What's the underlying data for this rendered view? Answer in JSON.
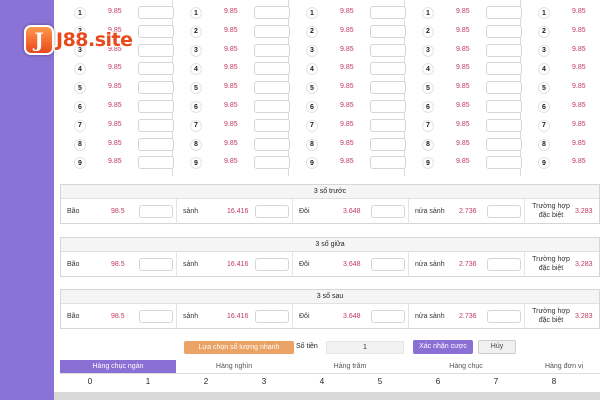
{
  "logo": {
    "mark": "J",
    "text": "J88.site"
  },
  "grid": {
    "rows": [
      {
        "num": "1",
        "rates": [
          "9.85",
          "9.85",
          "9.85",
          "9.85",
          "9.85"
        ]
      },
      {
        "num": "2",
        "rates": [
          "9.85",
          "9.85",
          "9.85",
          "9.85",
          "9.85"
        ]
      },
      {
        "num": "3",
        "rates": [
          "9.85",
          "9.85",
          "9.85",
          "9.85",
          "9.85"
        ]
      },
      {
        "num": "4",
        "rates": [
          "9.85",
          "9.85",
          "9.85",
          "9.85",
          "9.85"
        ]
      },
      {
        "num": "5",
        "rates": [
          "9.85",
          "9.85",
          "9.85",
          "9.85",
          "9.85"
        ]
      },
      {
        "num": "6",
        "rates": [
          "9.85",
          "9.85",
          "9.85",
          "9.85",
          "9.85"
        ]
      },
      {
        "num": "7",
        "rates": [
          "9.85",
          "9.85",
          "9.85",
          "9.85",
          "9.85"
        ]
      },
      {
        "num": "8",
        "rates": [
          "9.85",
          "9.85",
          "9.85",
          "9.85",
          "9.85"
        ]
      },
      {
        "num": "9",
        "rates": [
          "9.85",
          "9.85",
          "9.85",
          "9.85",
          "9.85"
        ]
      }
    ]
  },
  "panels": [
    {
      "title": "3 số trước",
      "items": [
        {
          "label": "Bão",
          "rate": "98.5"
        },
        {
          "label": "sảnh",
          "rate": "16.416"
        },
        {
          "label": "Đôi",
          "rate": "3.648"
        },
        {
          "label": "nửa sảnh",
          "rate": "2.736"
        },
        {
          "label": "Trường hợp đặc biệt",
          "rate": "3.283"
        }
      ]
    },
    {
      "title": "3 số giữa",
      "items": [
        {
          "label": "Bão",
          "rate": "98.5"
        },
        {
          "label": "sảnh",
          "rate": "16.416"
        },
        {
          "label": "Đôi",
          "rate": "3.648"
        },
        {
          "label": "nửa sảnh",
          "rate": "2.736"
        },
        {
          "label": "Trường hợp đặc biệt",
          "rate": "3.283"
        }
      ]
    },
    {
      "title": "3 số sau",
      "items": [
        {
          "label": "Bão",
          "rate": "98.5"
        },
        {
          "label": "sảnh",
          "rate": "16.416"
        },
        {
          "label": "Đôi",
          "rate": "3.648"
        },
        {
          "label": "nửa sảnh",
          "rate": "2.736"
        },
        {
          "label": "Trường hợp đặc biệt",
          "rate": "3.283"
        }
      ]
    }
  ],
  "bet_bar": {
    "quick_select_label": "Lựa chọn số lượng nhanh",
    "amount_label": "Số tiền",
    "amount_value": "1",
    "confirm_label": "Xác nhận cược",
    "cancel_label": "Hủy"
  },
  "place_tabs": [
    "Hàng chục ngàn",
    "Hàng nghìn",
    "Hàng trăm",
    "Hàng chục",
    "Hàng đơn vị"
  ],
  "digits": [
    "0",
    "1",
    "2",
    "3",
    "4",
    "5",
    "6",
    "7",
    "8"
  ],
  "colors": {
    "accent": "#8a6fd4",
    "sidebar": "#8a73d6",
    "rate": "#c0395d",
    "quick_button": "#eaa364"
  }
}
